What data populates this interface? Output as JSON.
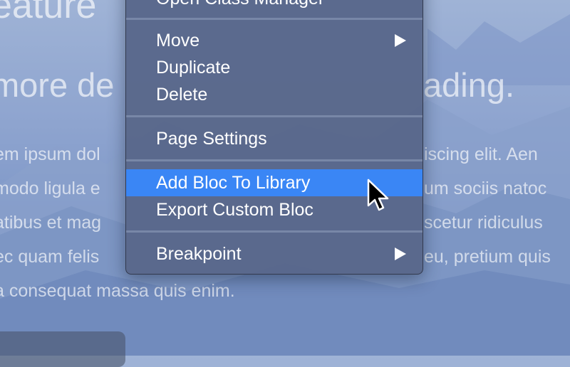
{
  "hero": {
    "title": "eature",
    "subtitle_left": "more de",
    "subtitle_right": "ading."
  },
  "body_text": {
    "lines_left": [
      "em ipsum dol",
      "modo ligula e",
      "atibus et mag",
      "ec quam felis"
    ],
    "lines_right": [
      "iscing elit. Aen",
      "um sociis natoc",
      "scetur ridiculus",
      "eu, pretium quis"
    ],
    "last_line": "a consequat massa quis enim."
  },
  "context_menu": {
    "items": [
      {
        "label": "Open Class Manager"
      },
      {
        "label": "Move",
        "submenu": true
      },
      {
        "label": "Duplicate"
      },
      {
        "label": "Delete"
      },
      {
        "label": "Page Settings"
      },
      {
        "label": "Add Bloc To Library",
        "highlighted": true
      },
      {
        "label": "Export Custom Bloc"
      },
      {
        "label": "Breakpoint",
        "submenu": true
      }
    ]
  },
  "colors": {
    "menu_background": "#58678a",
    "highlight": "#3a86f5",
    "menu_text": "#ffffff"
  }
}
